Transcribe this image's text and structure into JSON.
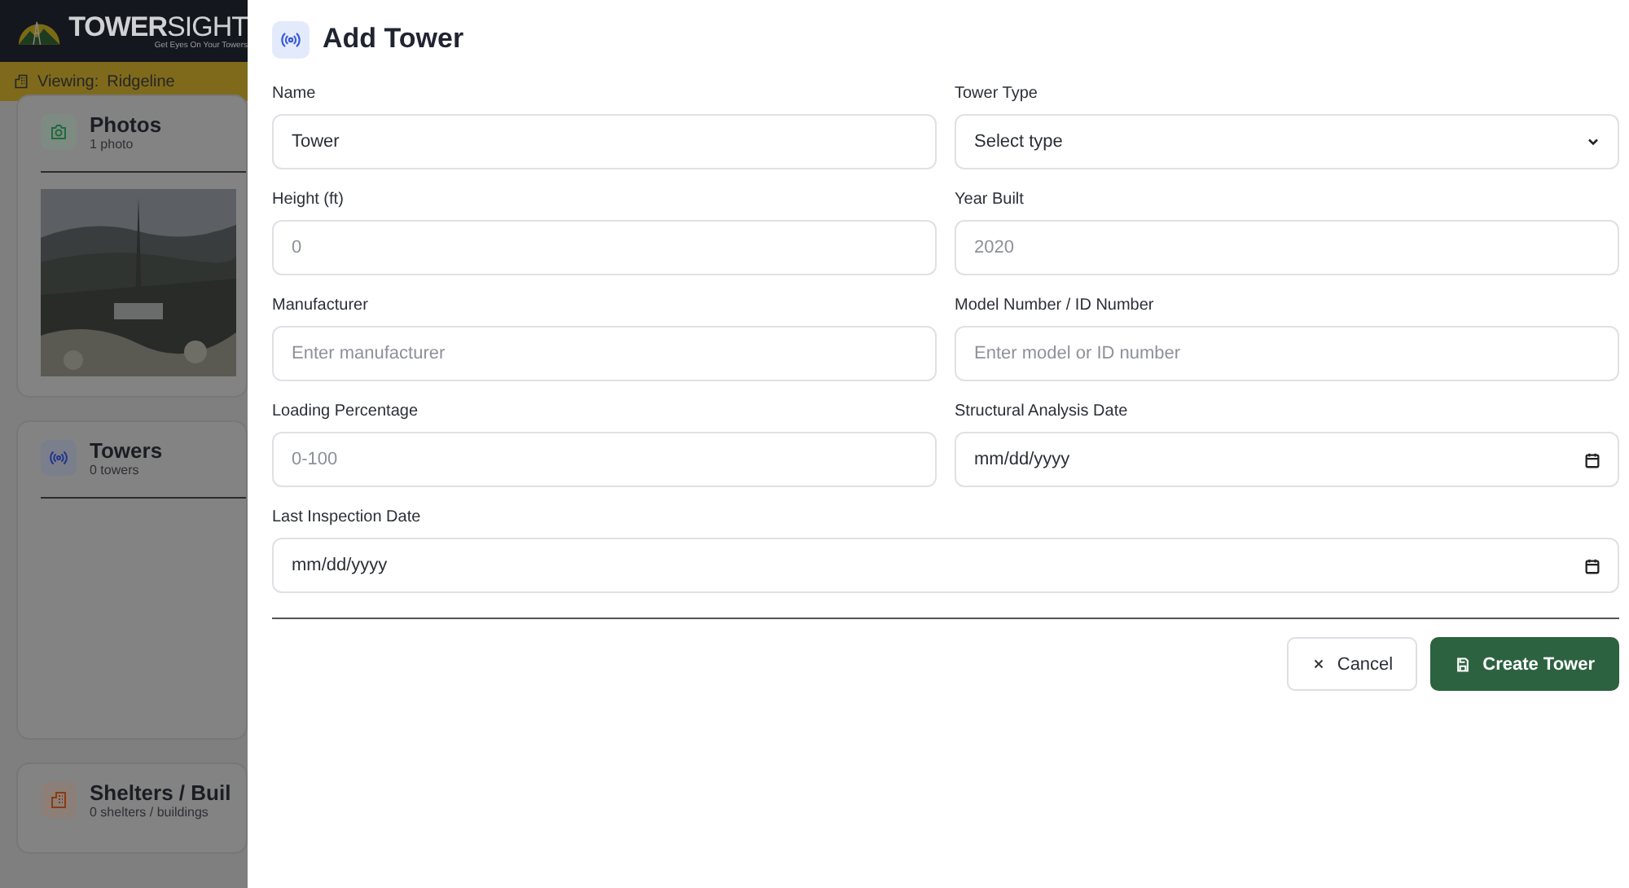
{
  "app": {
    "brand": "**TOWER**SIGHT",
    "tagline": "Get Eyes On Your Towers",
    "viewing_label": "Viewing:",
    "viewing_site": "Ridgeline"
  },
  "sections": [
    {
      "kind": "photos",
      "title": "Photos",
      "count": "1 photo"
    },
    {
      "kind": "towers",
      "title": "Towers",
      "count": "0 towers"
    },
    {
      "kind": "shelters",
      "title": "Shelters / Buil",
      "count": "0 shelters / buildings"
    }
  ],
  "dialog": {
    "title": "Add Tower",
    "fields": [
      {
        "kind": "text",
        "label": "Name",
        "value": "Tower",
        "full_width": false
      },
      {
        "kind": "select",
        "label": "Tower Type",
        "value": "Select type",
        "full_width": false
      },
      {
        "kind": "text",
        "label": "Height (ft)",
        "placeholder": "0",
        "full_width": false
      },
      {
        "kind": "text",
        "label": "Year Built",
        "placeholder": "2020",
        "full_width": false
      },
      {
        "kind": "text",
        "label": "Manufacturer",
        "placeholder": "Enter manufacturer",
        "full_width": false
      },
      {
        "kind": "text",
        "label": "Model Number / ID Number",
        "placeholder": "Enter model or ID number",
        "full_width": false
      },
      {
        "kind": "text",
        "label": "Loading Percentage",
        "placeholder": "0-100",
        "full_width": false
      },
      {
        "kind": "date",
        "label": "Structural Analysis Date",
        "value": "mm/dd/yyyy",
        "full_width": false
      },
      {
        "kind": "date",
        "label": "Last Inspection Date",
        "value": "mm/dd/yyyy",
        "full_width": true
      }
    ],
    "buttons": [
      {
        "kind": "secondary",
        "label": "Cancel"
      },
      {
        "kind": "primary",
        "label": "Create Tower"
      }
    ]
  }
}
